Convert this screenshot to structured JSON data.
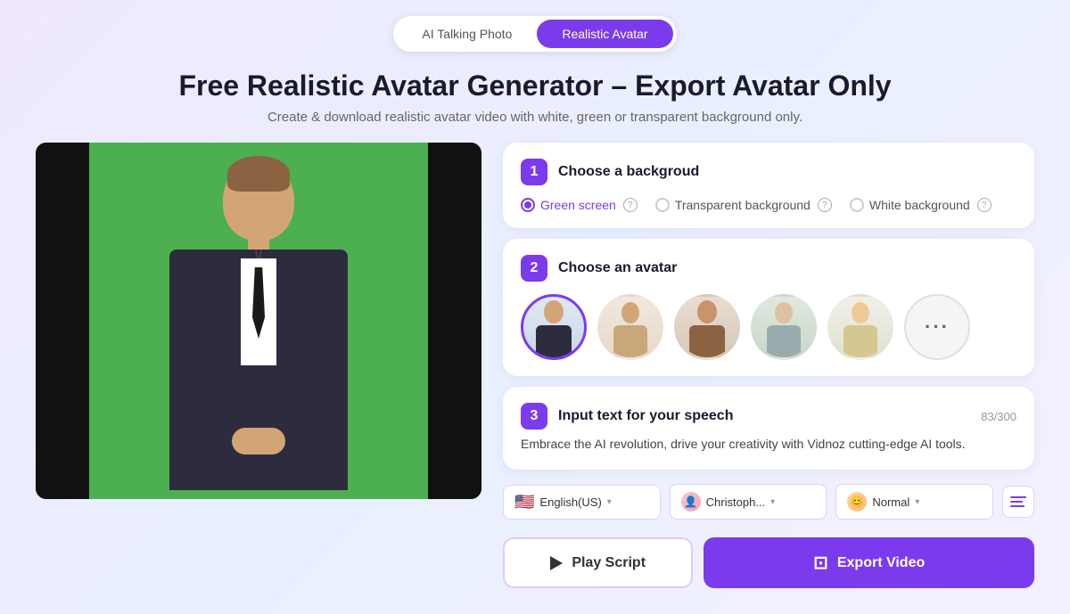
{
  "tabs": {
    "inactive_label": "AI Talking Photo",
    "active_label": "Realistic Avatar"
  },
  "hero": {
    "title": "Free Realistic Avatar Generator – Export Avatar Only",
    "subtitle": "Create & download realistic avatar video with white, green or transparent background only."
  },
  "step1": {
    "number": "1",
    "title": "Choose a backgroud",
    "options": [
      {
        "id": "green",
        "label": "Green screen",
        "selected": true
      },
      {
        "id": "transparent",
        "label": "Transparent background",
        "selected": false
      },
      {
        "id": "white",
        "label": "White background",
        "selected": false
      }
    ]
  },
  "step2": {
    "number": "2",
    "title": "Choose an avatar",
    "more_label": "···"
  },
  "step3": {
    "number": "3",
    "title": "Input text for your speech",
    "char_count": "83/300",
    "speech_text": "Embrace the AI revolution, drive your creativity with Vidnoz cutting-edge AI tools."
  },
  "controls": {
    "language": "English(US)",
    "voice_name": "Christoph...",
    "speed": "Normal",
    "chevron": "▾"
  },
  "actions": {
    "play_label": "Play Script",
    "export_label": "Export Video"
  }
}
